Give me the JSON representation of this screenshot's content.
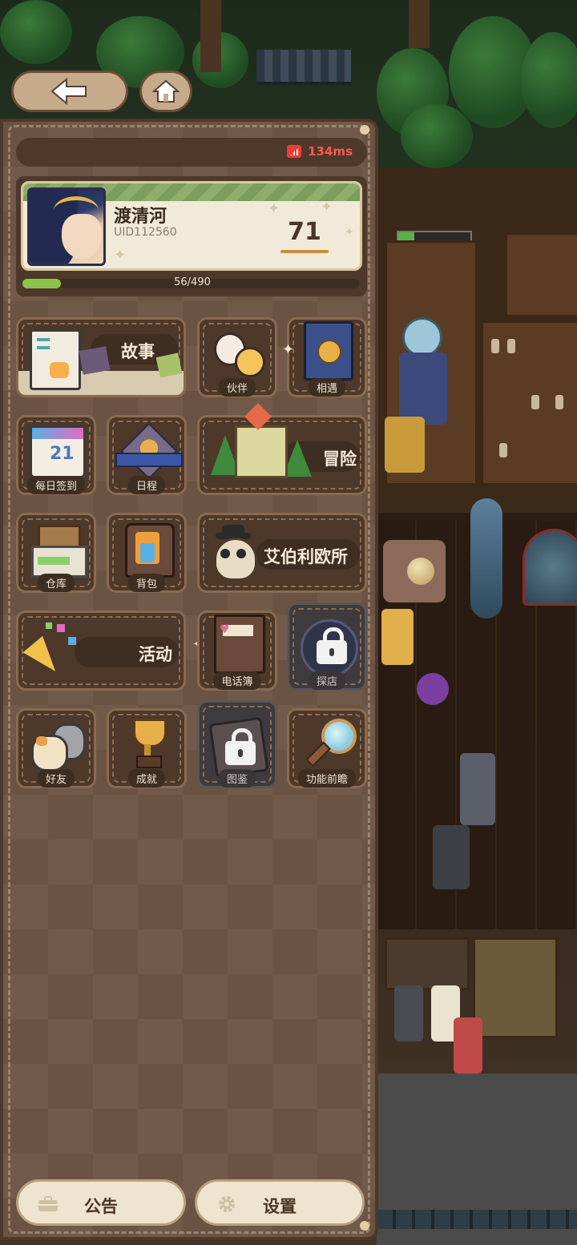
{
  "network": {
    "ping": "134ms"
  },
  "profile": {
    "name": "渡清河",
    "uid": "UID112560",
    "level": "71",
    "exp_text": "56/490",
    "exp_fraction": 0.114
  },
  "menu": {
    "story": "故事",
    "partner": "伙伴",
    "encounter": "相遇",
    "daily_signin": "每日签到",
    "daily_signin_date": "21",
    "schedule": "日程",
    "adventure": "冒险",
    "warehouse": "仓库",
    "backpack": "背包",
    "office": "艾伯利欧所",
    "activity": "活动",
    "phonebook": "电话簿",
    "explore_store": "探店",
    "friends": "好友",
    "achievements": "成就",
    "codex": "图鉴",
    "feature_preview": "功能前瞻"
  },
  "bottom": {
    "notice": "公告",
    "settings": "设置"
  },
  "colors": {
    "ping": "#ff5a4e",
    "exp": "#8ac24a",
    "panel": "#6b5343"
  }
}
